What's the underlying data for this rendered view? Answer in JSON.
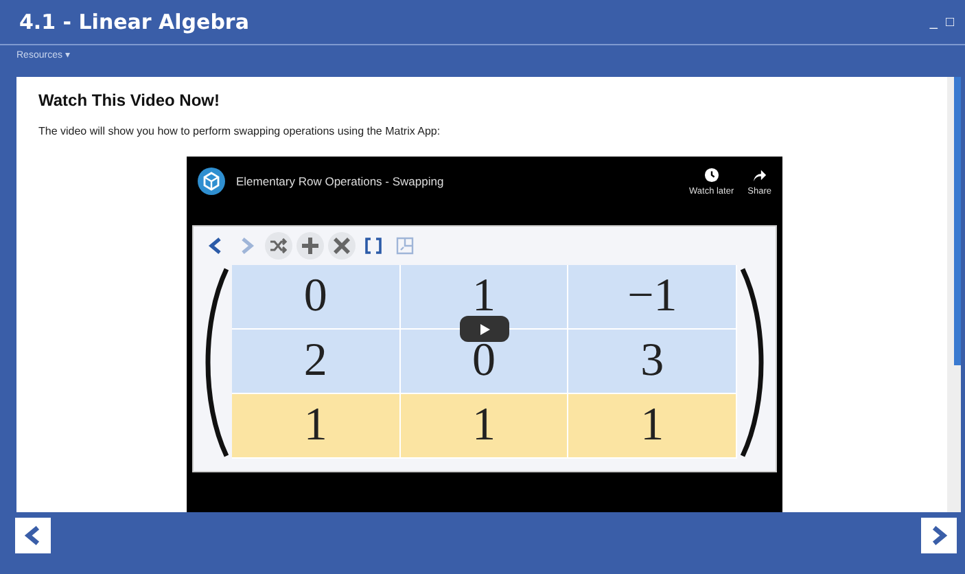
{
  "window": {
    "title": "4.1 - Linear Algebra",
    "controls": [
      "_",
      "□"
    ]
  },
  "menu": {
    "label": "Resources ▾"
  },
  "content": {
    "heading": "Watch This Video Now!",
    "intro": "The video will show you how to perform swapping operations using the Matrix App:"
  },
  "video": {
    "title": "Elementary Row Operations - Swapping",
    "actions": [
      {
        "kind": "clock",
        "label": "Watch later"
      },
      {
        "kind": "share",
        "label": "Share"
      }
    ],
    "toolbar": [
      {
        "kind": "back",
        "disabled": false
      },
      {
        "kind": "forward",
        "disabled": true
      },
      {
        "kind": "swap",
        "disabled": false
      },
      {
        "kind": "add",
        "disabled": false
      },
      {
        "kind": "multiply",
        "disabled": false
      },
      {
        "kind": "bracket",
        "disabled": false
      },
      {
        "kind": "resize",
        "disabled": true
      }
    ],
    "rows": [
      {
        "selected": false,
        "cells": [
          "0",
          "1",
          "−1"
        ]
      },
      {
        "selected": false,
        "cells": [
          "2",
          "0",
          "3"
        ]
      },
      {
        "selected": true,
        "cells": [
          "1",
          "1",
          "1"
        ]
      }
    ]
  },
  "nav": {
    "back": {
      "disabled": false
    },
    "next": {
      "disabled": false
    }
  }
}
